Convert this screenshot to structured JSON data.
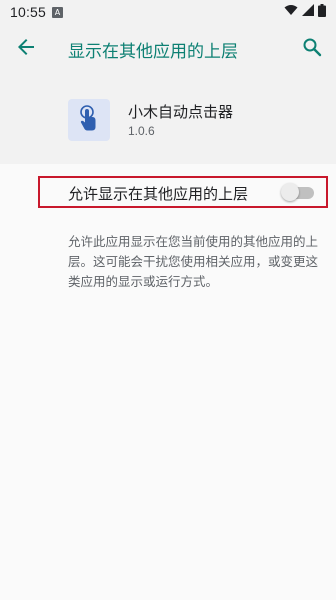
{
  "status_bar": {
    "time": "10:55",
    "notification_badge": "A",
    "icons": [
      "wifi-icon",
      "signal-icon",
      "battery-icon"
    ]
  },
  "header": {
    "title": "显示在其他应用的上层",
    "back_icon": "arrow-back-icon",
    "search_icon": "search-icon"
  },
  "app": {
    "name": "小木自动点击器",
    "version": "1.0.6",
    "icon": "tap-finger-icon"
  },
  "setting": {
    "label": "允许显示在其他应用的上层",
    "enabled": false
  },
  "description": "允许此应用显示在您当前使用的其他应用的上层。这可能会干扰您使用相关应用，或变更这类应用的显示或运行方式。",
  "colors": {
    "accent": "#0d8073",
    "highlight_border": "#c8182c",
    "header_bg": "#f2f2f2",
    "body_bg": "#fafafa"
  }
}
